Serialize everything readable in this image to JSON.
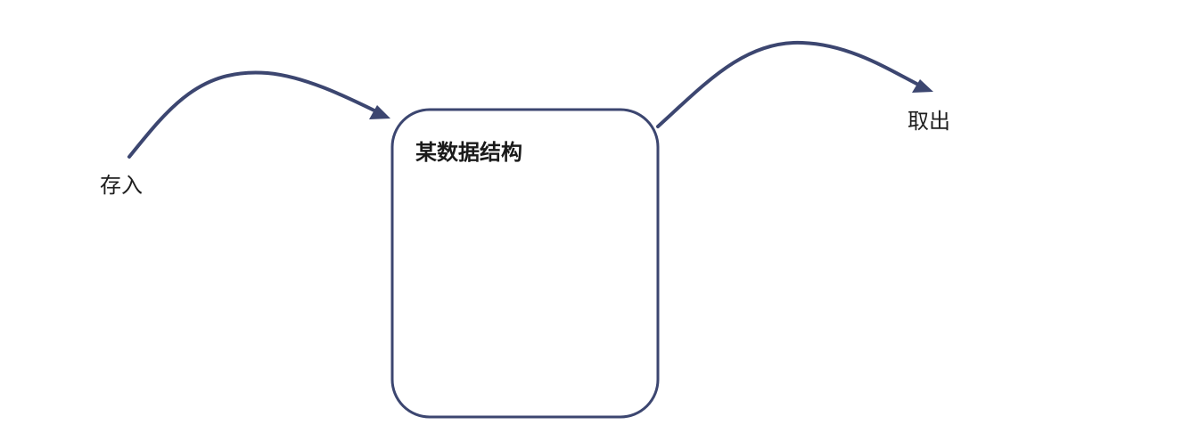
{
  "labels": {
    "input": "存入",
    "output": "取出",
    "structure": "某数据结构"
  },
  "colors": {
    "stroke": "#3c4670",
    "text": "#1e1e1e",
    "background": "#ffffff"
  }
}
